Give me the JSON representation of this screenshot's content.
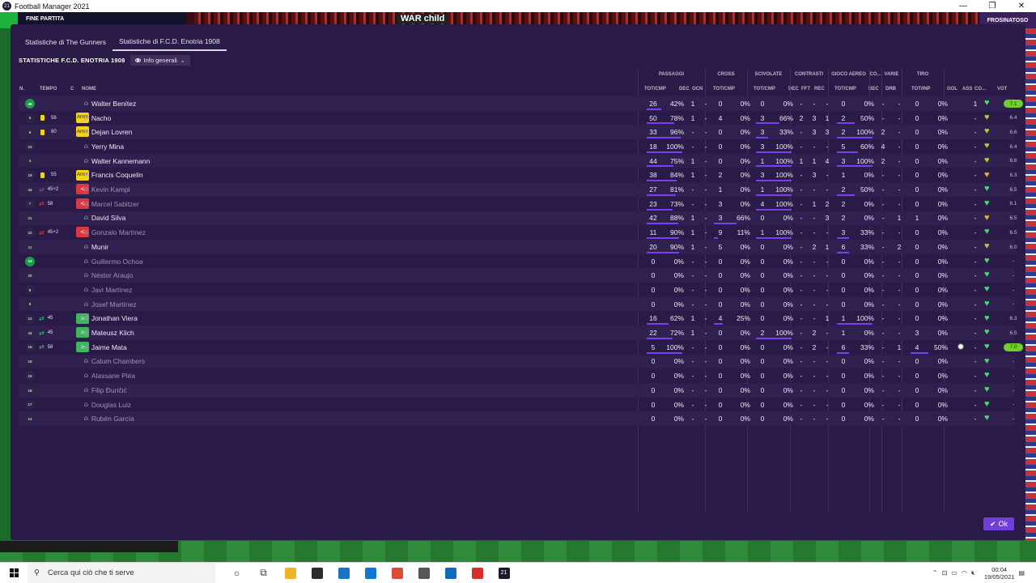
{
  "window": {
    "title": "Football Manager 2021",
    "app_icon": "21"
  },
  "background": {
    "match_status": "FINE PARTITA",
    "banner": "WAR child",
    "right_label": "FROSINATOSO"
  },
  "tabs": [
    {
      "label": "Statistiche di The Gunners",
      "active": false
    },
    {
      "label": "Statistiche di F.C.D. Enotria 1908",
      "active": true
    }
  ],
  "team_title": "STATISTICHE F.C.D. ENOTRIA 1908",
  "view_dropdown": "Info generali",
  "group_headers": [
    "PASSAGGI",
    "CROSS",
    "SCIVOLATE",
    "CONTRASTI",
    "GIOCO AEREO",
    "CO...",
    "VARIE",
    "TIRO"
  ],
  "col_headers": {
    "num": "N.",
    "tempo": "TEMPO",
    "c": "C",
    "nome": "NOME",
    "pass_tot": "TOT/CMP",
    "pass_dec": "DEC",
    "pass_ocn": "OCN",
    "cross": "TOT/CMP",
    "scivolate": "TOT/CMP",
    "con_dec": "DEC",
    "con_fft": "FFT",
    "con_rec": "REC",
    "aereo": "TOT/CMP",
    "co_dec": "DEC",
    "drb": "DRB",
    "tiro": "TOT/INP",
    "gol": "GOL",
    "ass": "ASS",
    "co": "CO...",
    "vot": "VOT"
  },
  "players": [
    {
      "num": "48",
      "gk": true,
      "tempo": "",
      "card": false,
      "sub": "",
      "c": "",
      "name": "Walter Benítez",
      "dim": false,
      "pass": "26",
      "pass_pct": "42%",
      "pass_frac": 0.42,
      "dec": "1",
      "ocn": "-",
      "cross": "0",
      "cross_pct": "0%",
      "cross_frac": 0,
      "sciv": "0",
      "sciv_pct": "0%",
      "sciv_frac": 0,
      "cdec": "-",
      "fft": "-",
      "rec": "-",
      "aereo": "0",
      "aereo_pct": "0%",
      "aereo_frac": 0,
      "codec": "-",
      "drb": "-",
      "tiro": "0",
      "tiro_pct": "0%",
      "tiro_frac": 0,
      "gol": "",
      "ass": "1",
      "heart": "#3ee06c",
      "vot": "7.1",
      "vot_high": true
    },
    {
      "num": "5",
      "gk": false,
      "tempo": "56",
      "card": true,
      "sub": "",
      "c": "Amm",
      "name": "Nacho",
      "dim": false,
      "pass": "50",
      "pass_pct": "78%",
      "pass_frac": 0.78,
      "dec": "1",
      "ocn": "-",
      "cross": "4",
      "cross_pct": "0%",
      "cross_frac": 0,
      "sciv": "3",
      "sciv_pct": "66%",
      "sciv_frac": 0.66,
      "cdec": "2",
      "fft": "3",
      "rec": "1",
      "aereo": "2",
      "aereo_pct": "50%",
      "aereo_frac": 0.5,
      "codec": "-",
      "drb": "-",
      "tiro": "0",
      "tiro_pct": "0%",
      "tiro_frac": 0,
      "gol": "",
      "ass": "-",
      "heart": "#a8d32e",
      "vot": "6.4",
      "vot_high": false
    },
    {
      "num": "6",
      "gk": false,
      "tempo": "80",
      "card": true,
      "sub": "",
      "c": "Amm",
      "name": "Dejan Lovren",
      "dim": false,
      "pass": "33",
      "pass_pct": "96%",
      "pass_frac": 0.96,
      "dec": "-",
      "ocn": "-",
      "cross": "0",
      "cross_pct": "0%",
      "cross_frac": 0,
      "sciv": "3",
      "sciv_pct": "33%",
      "sciv_frac": 0.33,
      "cdec": "-",
      "fft": "3",
      "rec": "3",
      "aereo": "2",
      "aereo_pct": "100%",
      "aereo_frac": 1,
      "codec": "2",
      "drb": "-",
      "tiro": "0",
      "tiro_pct": "0%",
      "tiro_frac": 0,
      "gol": "",
      "ass": "-",
      "heart": "#a8d32e",
      "vot": "6.6",
      "vot_high": false
    },
    {
      "num": "23",
      "gk": false,
      "tempo": "",
      "card": false,
      "sub": "",
      "c": "",
      "name": "Yerry Mina",
      "dim": false,
      "pass": "18",
      "pass_pct": "100%",
      "pass_frac": 1,
      "dec": "-",
      "ocn": "-",
      "cross": "0",
      "cross_pct": "0%",
      "cross_frac": 0,
      "sciv": "3",
      "sciv_pct": "100%",
      "sciv_frac": 1,
      "cdec": "-",
      "fft": "-",
      "rec": "-",
      "aereo": "5",
      "aereo_pct": "60%",
      "aereo_frac": 0.6,
      "codec": "4",
      "drb": "-",
      "tiro": "0",
      "tiro_pct": "0%",
      "tiro_frac": 0,
      "gol": "",
      "ass": "-",
      "heart": "#a8d32e",
      "vot": "6.4",
      "vot_high": false
    },
    {
      "num": "4",
      "gk": false,
      "tempo": "",
      "card": false,
      "sub": "",
      "c": "",
      "name": "Walter Kannemann",
      "dim": false,
      "pass": "44",
      "pass_pct": "75%",
      "pass_frac": 0.75,
      "dec": "1",
      "ocn": "-",
      "cross": "0",
      "cross_pct": "0%",
      "cross_frac": 0,
      "sciv": "1",
      "sciv_pct": "100%",
      "sciv_frac": 1,
      "cdec": "1",
      "fft": "1",
      "rec": "4",
      "aereo": "3",
      "aereo_pct": "100%",
      "aereo_frac": 1,
      "codec": "2",
      "drb": "-",
      "tiro": "0",
      "tiro_pct": "0%",
      "tiro_frac": 0,
      "gol": "",
      "ass": "-",
      "heart": "#a8d32e",
      "vot": "6.6",
      "vot_high": false
    },
    {
      "num": "19",
      "gk": false,
      "tempo": "55",
      "card": true,
      "sub": "",
      "c": "Amm",
      "name": "Francis Coquelin",
      "dim": false,
      "pass": "38",
      "pass_pct": "84%",
      "pass_frac": 0.84,
      "dec": "1",
      "ocn": "-",
      "cross": "2",
      "cross_pct": "0%",
      "cross_frac": 0,
      "sciv": "3",
      "sciv_pct": "100%",
      "sciv_frac": 1,
      "cdec": "-",
      "fft": "3",
      "rec": "-",
      "aereo": "1",
      "aereo_pct": "0%",
      "aereo_frac": 0,
      "codec": "-",
      "drb": "-",
      "tiro": "0",
      "tiro_pct": "0%",
      "tiro_frac": 0,
      "gol": "",
      "ass": "-",
      "heart": "#e8b030",
      "vot": "6.3",
      "vot_high": false
    },
    {
      "num": "44",
      "gk": false,
      "tempo": "45+2",
      "card": false,
      "sub": "out",
      "c": "<",
      "name": "Kevin Kampl",
      "dim": true,
      "pass": "27",
      "pass_pct": "81%",
      "pass_frac": 0.81,
      "dec": "-",
      "ocn": "-",
      "cross": "1",
      "cross_pct": "0%",
      "cross_frac": 0,
      "sciv": "1",
      "sciv_pct": "100%",
      "sciv_frac": 1,
      "cdec": "-",
      "fft": "-",
      "rec": "-",
      "aereo": "2",
      "aereo_pct": "50%",
      "aereo_frac": 0.5,
      "codec": "-",
      "drb": "-",
      "tiro": "0",
      "tiro_pct": "0%",
      "tiro_frac": 0,
      "gol": "",
      "ass": "-",
      "heart": "#3ee06c",
      "vot": "6.5",
      "vot_high": false
    },
    {
      "num": "7",
      "gk": false,
      "tempo": "58",
      "card": false,
      "sub": "out",
      "c": "<",
      "name": "Marcel Sabitzer",
      "dim": true,
      "pass": "23",
      "pass_pct": "73%",
      "pass_frac": 0.73,
      "dec": "-",
      "ocn": "-",
      "cross": "3",
      "cross_pct": "0%",
      "cross_frac": 0,
      "sciv": "4",
      "sciv_pct": "100%",
      "sciv_frac": 1,
      "cdec": "-",
      "fft": "1",
      "rec": "2",
      "aereo": "2",
      "aereo_pct": "0%",
      "aereo_frac": 0,
      "codec": "-",
      "drb": "-",
      "tiro": "0",
      "tiro_pct": "0%",
      "tiro_frac": 0,
      "gol": "",
      "ass": "-",
      "heart": "#3ee06c",
      "vot": "6.1",
      "vot_high": false
    },
    {
      "num": "21",
      "gk": false,
      "tempo": "",
      "card": false,
      "sub": "",
      "c": "",
      "name": "David Silva",
      "dim": false,
      "pass": "42",
      "pass_pct": "88%",
      "pass_frac": 0.88,
      "dec": "1",
      "ocn": "-",
      "cross": "3",
      "cross_pct": "66%",
      "cross_frac": 0.66,
      "sciv": "0",
      "sciv_pct": "0%",
      "sciv_frac": 0,
      "cdec": "-",
      "fft": "-",
      "rec": "3",
      "aereo": "2",
      "aereo_pct": "0%",
      "aereo_frac": 0,
      "codec": "-",
      "drb": "1",
      "tiro": "1",
      "tiro_pct": "0%",
      "tiro_frac": 0,
      "gol": "",
      "ass": "-",
      "heart": "#e8b030",
      "vot": "6.5",
      "vot_high": false
    },
    {
      "num": "22",
      "gk": false,
      "tempo": "45+2",
      "card": false,
      "sub": "out",
      "c": "<",
      "name": "Gonzalo Martínez",
      "dim": true,
      "pass": "11",
      "pass_pct": "90%",
      "pass_frac": 0.9,
      "dec": "1",
      "ocn": "-",
      "cross": "9",
      "cross_pct": "11%",
      "cross_frac": 0.11,
      "sciv": "1",
      "sciv_pct": "100%",
      "sciv_frac": 1,
      "cdec": "-",
      "fft": "-",
      "rec": "-",
      "aereo": "3",
      "aereo_pct": "33%",
      "aereo_frac": 0.33,
      "codec": "-",
      "drb": "-",
      "tiro": "0",
      "tiro_pct": "0%",
      "tiro_frac": 0,
      "gol": "",
      "ass": "-",
      "heart": "#3ee06c",
      "vot": "6.5",
      "vot_high": false
    },
    {
      "num": "11",
      "gk": false,
      "tempo": "",
      "card": false,
      "sub": "",
      "c": "",
      "name": "Munir",
      "dim": false,
      "pass": "20",
      "pass_pct": "90%",
      "pass_frac": 0.9,
      "dec": "1",
      "ocn": "-",
      "cross": "5",
      "cross_pct": "0%",
      "cross_frac": 0,
      "sciv": "0",
      "sciv_pct": "0%",
      "sciv_frac": 0,
      "cdec": "-",
      "fft": "2",
      "rec": "1",
      "aereo": "6",
      "aereo_pct": "33%",
      "aereo_frac": 0.33,
      "codec": "-",
      "drb": "2",
      "tiro": "0",
      "tiro_pct": "0%",
      "tiro_frac": 0,
      "gol": "",
      "ass": "-",
      "heart": "#a8d32e",
      "vot": "6.0",
      "vot_high": false
    },
    {
      "num": "13",
      "gk": true,
      "tempo": "",
      "card": false,
      "sub": "",
      "c": "",
      "name": "Guillermo Ochoa",
      "dim": true,
      "pass": "0",
      "pass_pct": "0%",
      "pass_frac": 0,
      "dec": "-",
      "ocn": "-",
      "cross": "0",
      "cross_pct": "0%",
      "cross_frac": 0,
      "sciv": "0",
      "sciv_pct": "0%",
      "sciv_frac": 0,
      "cdec": "-",
      "fft": "-",
      "rec": "-",
      "aereo": "0",
      "aereo_pct": "0%",
      "aereo_frac": 0,
      "codec": "-",
      "drb": "-",
      "tiro": "0",
      "tiro_pct": "0%",
      "tiro_frac": 0,
      "gol": "",
      "ass": "-",
      "heart": "#3ee06c",
      "vot": "-",
      "vot_high": false
    },
    {
      "num": "20",
      "gk": false,
      "tempo": "",
      "card": false,
      "sub": "",
      "c": "",
      "name": "Néstor Araujo",
      "dim": true,
      "pass": "0",
      "pass_pct": "0%",
      "pass_frac": 0,
      "dec": "-",
      "ocn": "-",
      "cross": "0",
      "cross_pct": "0%",
      "cross_frac": 0,
      "sciv": "0",
      "sciv_pct": "0%",
      "sciv_frac": 0,
      "cdec": "-",
      "fft": "-",
      "rec": "-",
      "aereo": "0",
      "aereo_pct": "0%",
      "aereo_frac": 0,
      "codec": "-",
      "drb": "-",
      "tiro": "0",
      "tiro_pct": "0%",
      "tiro_frac": 0,
      "gol": "",
      "ass": "-",
      "heart": "#3ee06c",
      "vot": "-",
      "vot_high": false
    },
    {
      "num": "8",
      "gk": false,
      "tempo": "",
      "card": false,
      "sub": "",
      "c": "",
      "name": "Javi Martínez",
      "dim": true,
      "pass": "0",
      "pass_pct": "0%",
      "pass_frac": 0,
      "dec": "-",
      "ocn": "-",
      "cross": "0",
      "cross_pct": "0%",
      "cross_frac": 0,
      "sciv": "0",
      "sciv_pct": "0%",
      "sciv_frac": 0,
      "cdec": "-",
      "fft": "-",
      "rec": "-",
      "aereo": "0",
      "aereo_pct": "0%",
      "aereo_frac": 0,
      "codec": "-",
      "drb": "-",
      "tiro": "0",
      "tiro_pct": "0%",
      "tiro_frac": 0,
      "gol": "",
      "ass": "-",
      "heart": "#3ee06c",
      "vot": "-",
      "vot_high": false
    },
    {
      "num": "9",
      "gk": false,
      "tempo": "",
      "card": false,
      "sub": "",
      "c": "",
      "name": "Josef Martínez",
      "dim": true,
      "pass": "0",
      "pass_pct": "0%",
      "pass_frac": 0,
      "dec": "-",
      "ocn": "-",
      "cross": "0",
      "cross_pct": "0%",
      "cross_frac": 0,
      "sciv": "0",
      "sciv_pct": "0%",
      "sciv_frac": 0,
      "cdec": "-",
      "fft": "-",
      "rec": "-",
      "aereo": "0",
      "aereo_pct": "0%",
      "aereo_frac": 0,
      "codec": "-",
      "drb": "-",
      "tiro": "0",
      "tiro_pct": "0%",
      "tiro_frac": 0,
      "gol": "",
      "ass": "-",
      "heart": "#3ee06c",
      "vot": "-",
      "vot_high": false
    },
    {
      "num": "12",
      "gk": false,
      "tempo": "45",
      "card": false,
      "sub": "in",
      "c": ">",
      "name": "Jonathan Viera",
      "dim": false,
      "pass": "16",
      "pass_pct": "62%",
      "pass_frac": 0.62,
      "dec": "1",
      "ocn": "-",
      "cross": "4",
      "cross_pct": "25%",
      "cross_frac": 0.25,
      "sciv": "0",
      "sciv_pct": "0%",
      "sciv_frac": 0,
      "cdec": "-",
      "fft": "-",
      "rec": "1",
      "aereo": "1",
      "aereo_pct": "100%",
      "aereo_frac": 1,
      "codec": "-",
      "drb": "-",
      "tiro": "0",
      "tiro_pct": "0%",
      "tiro_frac": 0,
      "gol": "",
      "ass": "-",
      "heart": "#3ee06c",
      "vot": "6.3",
      "vot_high": false
    },
    {
      "num": "43",
      "gk": false,
      "tempo": "45",
      "card": false,
      "sub": "in",
      "c": ">",
      "name": "Mateusz Klich",
      "dim": false,
      "pass": "22",
      "pass_pct": "72%",
      "pass_frac": 0.72,
      "dec": "1",
      "ocn": "-",
      "cross": "0",
      "cross_pct": "0%",
      "cross_frac": 0,
      "sciv": "2",
      "sciv_pct": "100%",
      "sciv_frac": 1,
      "cdec": "-",
      "fft": "2",
      "rec": "-",
      "aereo": "1",
      "aereo_pct": "0%",
      "aereo_frac": 0,
      "codec": "-",
      "drb": "-",
      "tiro": "3",
      "tiro_pct": "0%",
      "tiro_frac": 0,
      "gol": "",
      "ass": "-",
      "heart": "#3ee06c",
      "vot": "6.5",
      "vot_high": false
    },
    {
      "num": "16",
      "gk": false,
      "tempo": "58",
      "card": false,
      "sub": "in",
      "c": ">",
      "name": "Jaime Mata",
      "dim": false,
      "pass": "5",
      "pass_pct": "100%",
      "pass_frac": 1,
      "dec": "-",
      "ocn": "-",
      "cross": "0",
      "cross_pct": "0%",
      "cross_frac": 0,
      "sciv": "0",
      "sciv_pct": "0%",
      "sciv_frac": 0,
      "cdec": "-",
      "fft": "2",
      "rec": "-",
      "aereo": "6",
      "aereo_pct": "33%",
      "aereo_frac": 0.33,
      "codec": "-",
      "drb": "1",
      "tiro": "4",
      "tiro_pct": "50%",
      "tiro_frac": 0.5,
      "gol": "ball",
      "ass": "-",
      "heart": "#3ee06c",
      "vot": "7.0",
      "vot_high": true
    },
    {
      "num": "18",
      "gk": false,
      "tempo": "",
      "card": false,
      "sub": "",
      "c": "",
      "name": "Calum Chambers",
      "dim": true,
      "pass": "0",
      "pass_pct": "0%",
      "pass_frac": 0,
      "dec": "-",
      "ocn": "-",
      "cross": "0",
      "cross_pct": "0%",
      "cross_frac": 0,
      "sciv": "0",
      "sciv_pct": "0%",
      "sciv_frac": 0,
      "cdec": "-",
      "fft": "-",
      "rec": "-",
      "aereo": "0",
      "aereo_pct": "0%",
      "aereo_frac": 0,
      "codec": "-",
      "drb": "-",
      "tiro": "0",
      "tiro_pct": "0%",
      "tiro_frac": 0,
      "gol": "",
      "ass": "-",
      "heart": "#3ee06c",
      "vot": "-",
      "vot_high": false
    },
    {
      "num": "15",
      "gk": false,
      "tempo": "",
      "card": false,
      "sub": "",
      "c": "",
      "name": "Alassane Pléa",
      "dim": true,
      "pass": "0",
      "pass_pct": "0%",
      "pass_frac": 0,
      "dec": "-",
      "ocn": "-",
      "cross": "0",
      "cross_pct": "0%",
      "cross_frac": 0,
      "sciv": "0",
      "sciv_pct": "0%",
      "sciv_frac": 0,
      "cdec": "-",
      "fft": "-",
      "rec": "-",
      "aereo": "0",
      "aereo_pct": "0%",
      "aereo_frac": 0,
      "codec": "-",
      "drb": "-",
      "tiro": "0",
      "tiro_pct": "0%",
      "tiro_frac": 0,
      "gol": "",
      "ass": "-",
      "heart": "#3ee06c",
      "vot": "-",
      "vot_high": false
    },
    {
      "num": "18",
      "gk": false,
      "tempo": "",
      "card": false,
      "sub": "",
      "c": "",
      "name": "Filip Đuričić",
      "dim": true,
      "pass": "0",
      "pass_pct": "0%",
      "pass_frac": 0,
      "dec": "-",
      "ocn": "-",
      "cross": "0",
      "cross_pct": "0%",
      "cross_frac": 0,
      "sciv": "0",
      "sciv_pct": "0%",
      "sciv_frac": 0,
      "cdec": "-",
      "fft": "-",
      "rec": "-",
      "aereo": "0",
      "aereo_pct": "0%",
      "aereo_frac": 0,
      "codec": "-",
      "drb": "-",
      "tiro": "0",
      "tiro_pct": "0%",
      "tiro_frac": 0,
      "gol": "",
      "ass": "-",
      "heart": "#3ee06c",
      "vot": "-",
      "vot_high": false
    },
    {
      "num": "17",
      "gk": false,
      "tempo": "",
      "card": false,
      "sub": "",
      "c": "",
      "name": "Douglas Luiz",
      "dim": true,
      "pass": "0",
      "pass_pct": "0%",
      "pass_frac": 0,
      "dec": "-",
      "ocn": "-",
      "cross": "0",
      "cross_pct": "0%",
      "cross_frac": 0,
      "sciv": "0",
      "sciv_pct": "0%",
      "sciv_frac": 0,
      "cdec": "-",
      "fft": "-",
      "rec": "-",
      "aereo": "0",
      "aereo_pct": "0%",
      "aereo_frac": 0,
      "codec": "-",
      "drb": "-",
      "tiro": "0",
      "tiro_pct": "0%",
      "tiro_frac": 0,
      "gol": "",
      "ass": "-",
      "heart": "#3ee06c",
      "vot": "-",
      "vot_high": false
    },
    {
      "num": "14",
      "gk": false,
      "tempo": "",
      "card": false,
      "sub": "",
      "c": "",
      "name": "Rubén García",
      "dim": true,
      "pass": "0",
      "pass_pct": "0%",
      "pass_frac": 0,
      "dec": "-",
      "ocn": "-",
      "cross": "0",
      "cross_pct": "0%",
      "cross_frac": 0,
      "sciv": "0",
      "sciv_pct": "0%",
      "sciv_frac": 0,
      "cdec": "-",
      "fft": "-",
      "rec": "-",
      "aereo": "0",
      "aereo_pct": "0%",
      "aereo_frac": 0,
      "codec": "-",
      "drb": "-",
      "tiro": "0",
      "tiro_pct": "0%",
      "tiro_frac": 0,
      "gol": "",
      "ass": "-",
      "heart": "#3ee06c",
      "vot": "-",
      "vot_high": false
    }
  ],
  "ok_button": "Ok",
  "taskbar": {
    "search_placeholder": "Cerca qui ciò che ti serve",
    "apps": [
      {
        "icon": "cortana-icon",
        "glyph": "○",
        "bg": ""
      },
      {
        "icon": "task-view-icon",
        "glyph": "⧉",
        "bg": ""
      },
      {
        "icon": "file-explorer-icon",
        "glyph": "",
        "bg": "#f0b429"
      },
      {
        "icon": "store-icon",
        "glyph": "",
        "bg": "#2d2d2d"
      },
      {
        "icon": "dell-icon",
        "glyph": "",
        "bg": "#1a74c4"
      },
      {
        "icon": "mail-icon",
        "glyph": "",
        "bg": "#0f78d4"
      },
      {
        "icon": "chrome-icon",
        "glyph": "",
        "bg": "#dd4b39"
      },
      {
        "icon": "calculator-icon",
        "glyph": "",
        "bg": "#555555"
      },
      {
        "icon": "camera-icon",
        "glyph": "",
        "bg": "#0f6cbd"
      },
      {
        "icon": "acrobat-icon",
        "glyph": "",
        "bg": "#d32f2f"
      },
      {
        "icon": "fm21-icon",
        "glyph": "21",
        "bg": "#1a1a2e"
      }
    ],
    "time": "00:04",
    "date": "19/05/2021"
  }
}
